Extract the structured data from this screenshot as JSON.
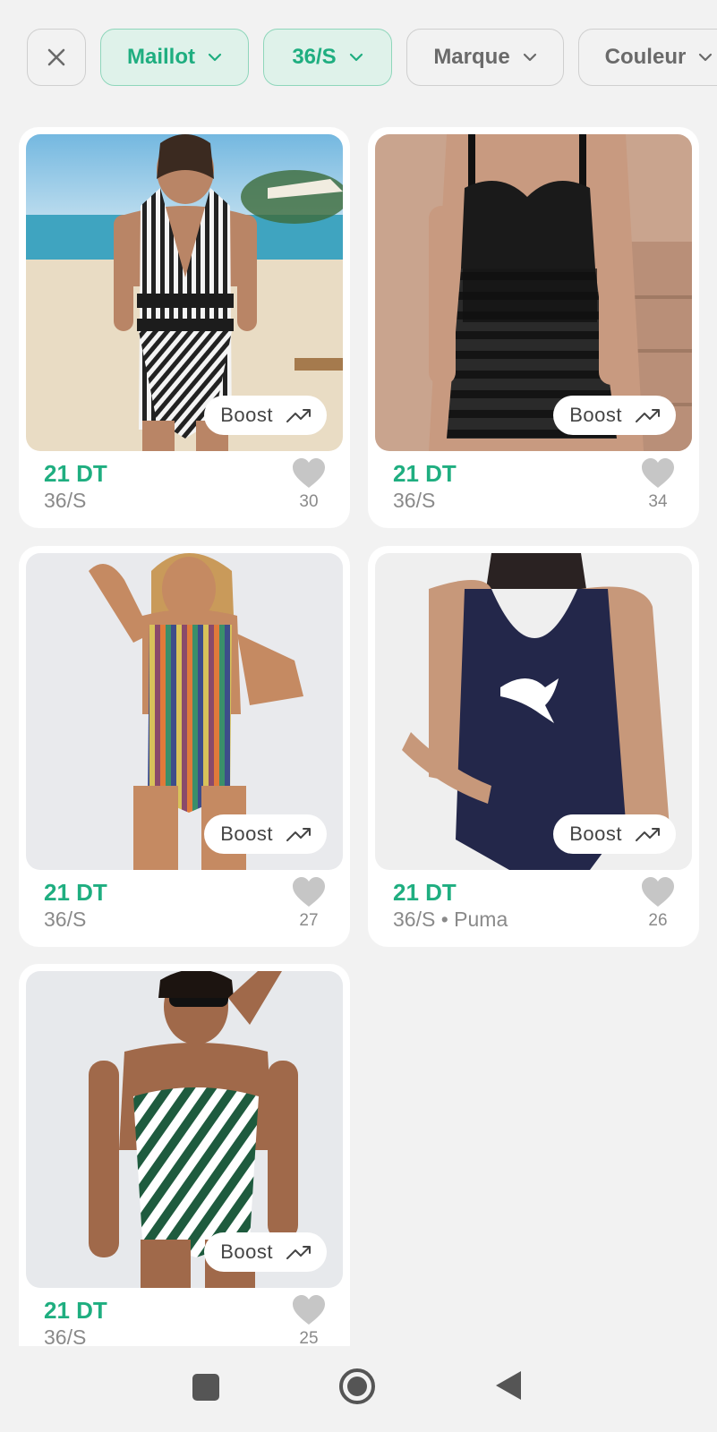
{
  "filters": {
    "clear_icon": "close-icon",
    "category": "Maillot",
    "size": "36/S",
    "brand": "Marque",
    "color": "Couleur"
  },
  "boost_label": "Boost",
  "products": [
    {
      "price": "21 DT",
      "details": "36/S",
      "likes": "30",
      "image": "black-white-striped-halter-swimsuit-on-beach"
    },
    {
      "price": "21 DT",
      "details": "36/S",
      "likes": "34",
      "image": "black-mesh-ruched-swimsuit"
    },
    {
      "price": "21 DT",
      "details": "36/S",
      "likes": "27",
      "image": "multicolor-vertical-striped-swimsuit"
    },
    {
      "price": "21 DT",
      "details": "36/S • Puma",
      "likes": "26",
      "image": "navy-puma-swimsuit"
    },
    {
      "price": "21 DT",
      "details": "36/S",
      "likes": "25",
      "image": "green-white-chevron-cutout-swimsuit"
    }
  ],
  "colors": {
    "accent": "#1fae80",
    "chip_active_bg": "#dff2ea",
    "background": "#f2f2f2"
  },
  "nav": [
    "recents-button",
    "home-button",
    "back-button"
  ]
}
